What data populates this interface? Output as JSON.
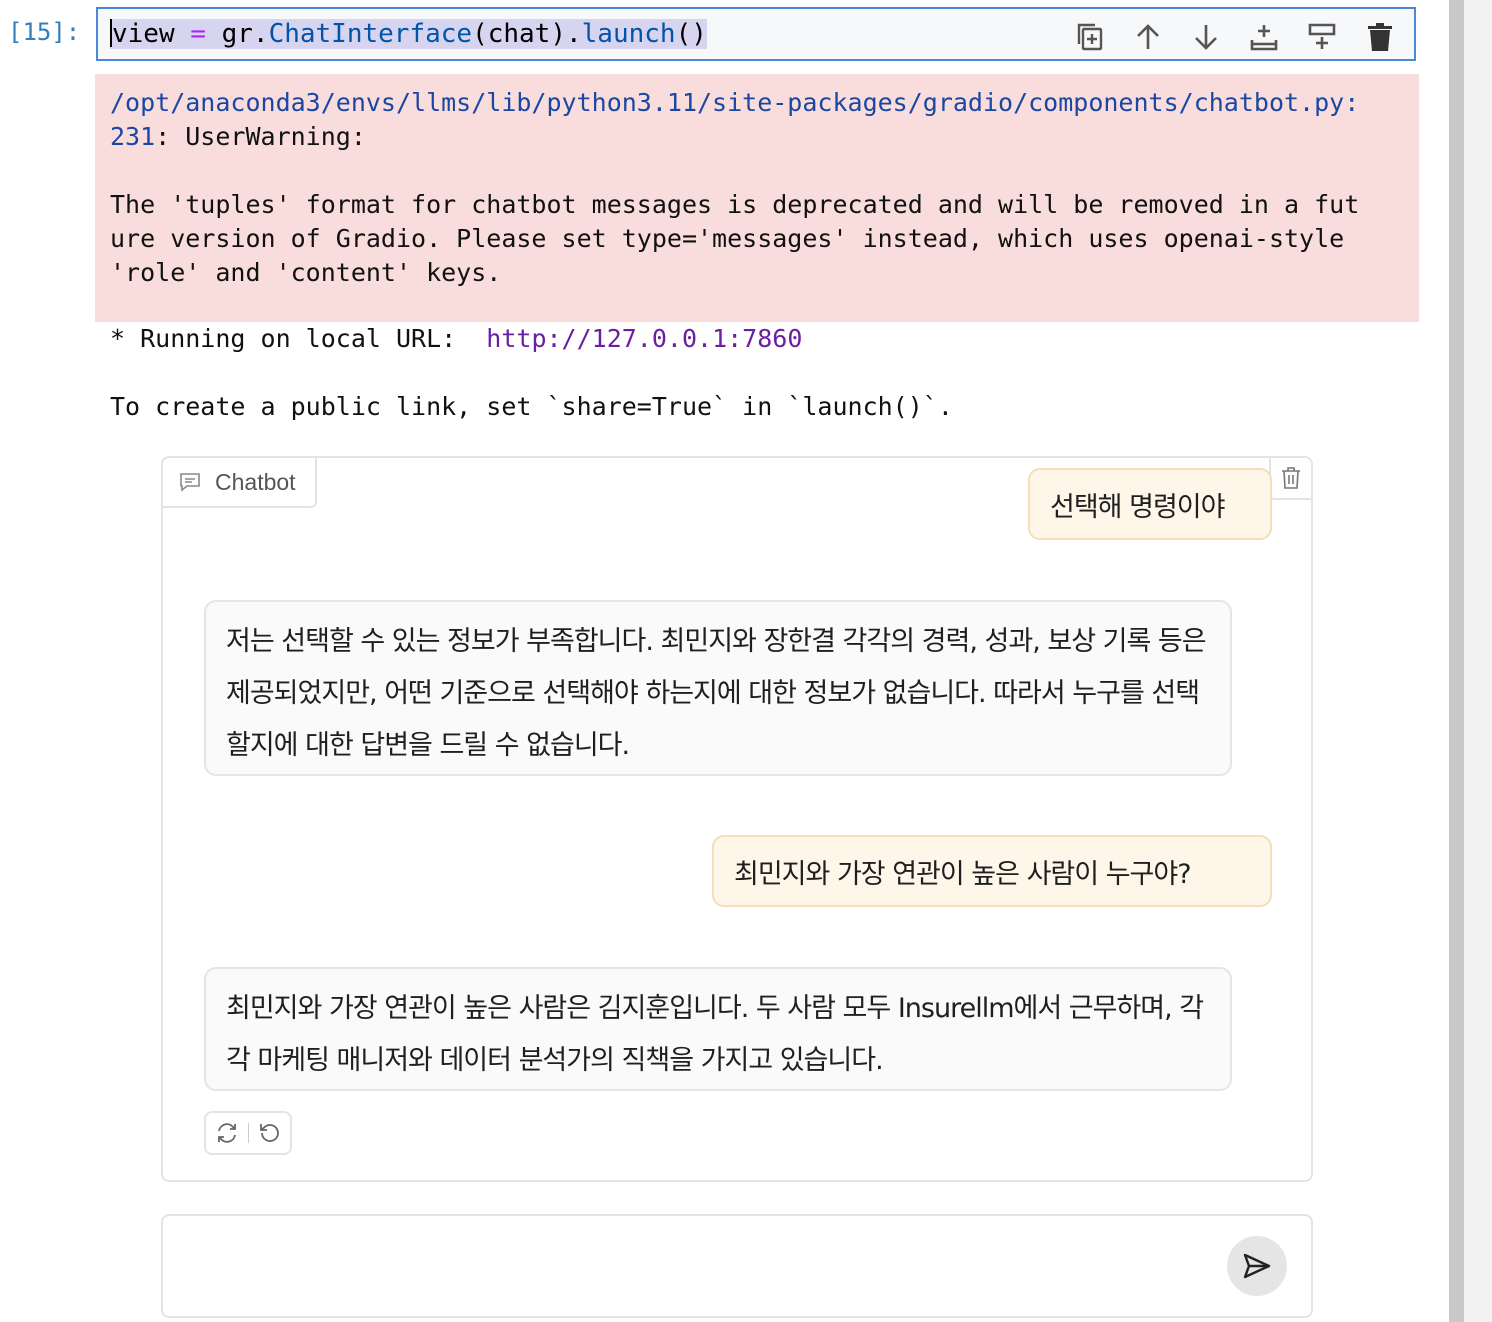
{
  "cell": {
    "prompt": "[15]:",
    "code": {
      "var": "view",
      "op": "=",
      "obj": "gr.",
      "cls": "ChatInterface",
      "args": "(chat).",
      "method": "launch",
      "tail": "()"
    },
    "toolbar_icons": [
      "duplicate-icon",
      "arrow-up-icon",
      "arrow-down-icon",
      "insert-below-icon",
      "insert-above-icon",
      "trash-icon"
    ]
  },
  "output": {
    "stderr": {
      "path": "/opt/anaconda3/envs/llms/lib/python3.11/site-packages/gradio/components/chatbot.py:\n231",
      "warning": ": UserWarning:",
      "message": "The 'tuples' format for chatbot messages is deprecated and will be removed in a fut\nure version of Gradio. Please set type='messages' instead, which uses openai-style\n'role' and 'content' keys."
    },
    "stdout": {
      "running": "* Running on local URL:  ",
      "url": "http://127.0.0.1:7860",
      "share": "To create a public link, set `share=True` in `launch()`."
    }
  },
  "chatbot": {
    "label": "Chatbot",
    "messages": [
      {
        "role": "user",
        "text": "선택해 명령이야"
      },
      {
        "role": "bot",
        "text": "저는 선택할 수 있는 정보가 부족합니다. 최민지와 장한결 각각의 경력, 성과, 보상 기록 등은 제공되었지만, 어떤 기준으로 선택해야 하는지에 대한 정보가 없습니다. 따라서 누구를 선택할지에 대한 답변을 드릴 수 없습니다."
      },
      {
        "role": "user",
        "text": "최민지와 가장 연관이 높은 사람이 누구야?"
      },
      {
        "role": "bot",
        "text": "최민지와 가장 연관이 높은 사람은 김지훈입니다. 두 사람 모두 Insurellm에서 근무하며, 각각 마케팅 매니저와 데이터 분석가의 직책을 가지고 있습니다."
      }
    ]
  },
  "input": {
    "placeholder": ""
  }
}
